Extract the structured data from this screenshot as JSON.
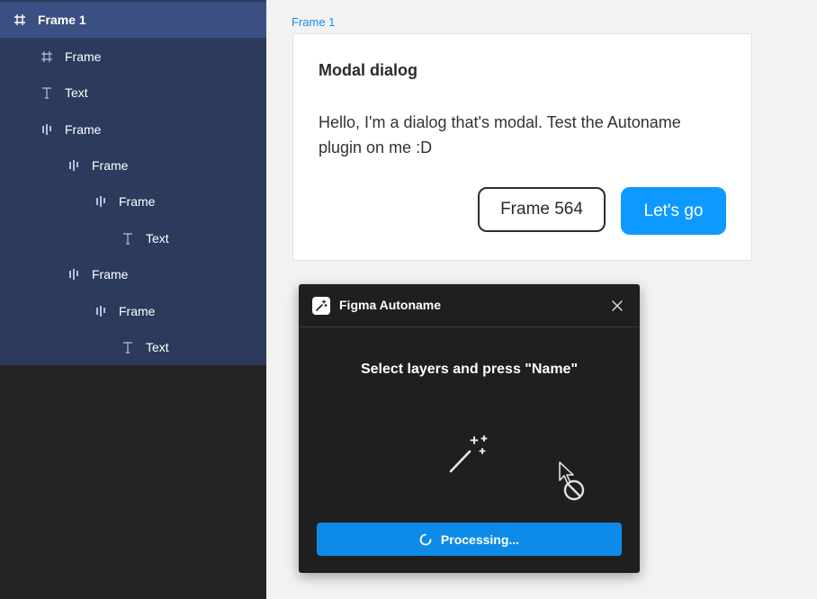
{
  "layers": {
    "items": [
      {
        "label": "Frame 1",
        "icon": "frame-icon",
        "depth": 0
      },
      {
        "label": "Frame",
        "icon": "frame-icon",
        "depth": 1
      },
      {
        "label": "Text",
        "icon": "text-icon",
        "depth": 1
      },
      {
        "label": "Frame",
        "icon": "auto-layout-icon",
        "depth": 1
      },
      {
        "label": "Frame",
        "icon": "auto-layout-icon",
        "depth": 2
      },
      {
        "label": "Frame",
        "icon": "auto-layout-icon",
        "depth": 3
      },
      {
        "label": "Text",
        "icon": "text-icon",
        "depth": 4
      },
      {
        "label": "Frame",
        "icon": "auto-layout-icon",
        "depth": 2
      },
      {
        "label": "Frame",
        "icon": "auto-layout-icon",
        "depth": 3
      },
      {
        "label": "Text",
        "icon": "text-icon",
        "depth": 4
      }
    ]
  },
  "canvas": {
    "frame_label": "Frame 1",
    "modal": {
      "title": "Modal dialog",
      "body": "Hello, I'm a dialog that's modal. Test the Autoname plugin on me :D",
      "secondary_button": "Frame 564",
      "primary_button": "Let's go"
    }
  },
  "plugin": {
    "title": "Figma Autoname",
    "instruction": "Select layers and press \"Name\"",
    "progress_label": "Processing..."
  },
  "colors": {
    "accent": "#0d99ff",
    "selection": "#2c3b5c",
    "panel": "#242424",
    "plugin_bg": "#1f1f1f"
  }
}
